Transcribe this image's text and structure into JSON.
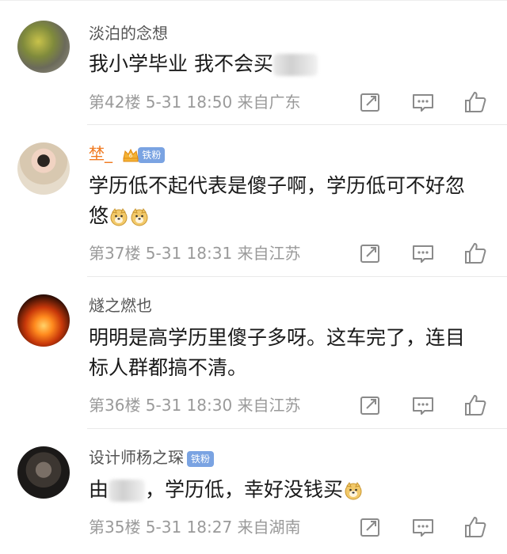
{
  "comments": [
    {
      "username": "淡泊的念想",
      "text": "我小学毕业 我不会买",
      "meta": "第42楼  5-31 18:50  来自广东"
    },
    {
      "username": "埜_",
      "badge": "铁粉",
      "crown_level": "6",
      "text_line1": "学历低不起代表是傻子啊，学历低可不好忽",
      "text_line2": "悠",
      "meta": "第37楼  5-31 18:31  来自江苏"
    },
    {
      "username": "燧之燃也",
      "text_line1": "明明是高学历里傻子多呀。这车完了，连目",
      "text_line2": "标人群都搞不清。",
      "meta": "第36楼  5-31 18:30  来自江苏"
    },
    {
      "username": "设计师杨之琛",
      "badge": "铁粉",
      "text_prefix": "由",
      "text": "，学历低，幸好没钱买",
      "meta": "第35楼  5-31 18:27  来自湖南"
    }
  ],
  "icons": {
    "share": "share-icon",
    "comment": "comment-icon",
    "like": "thumbs-up-icon",
    "emoji": "doge-emoji-icon"
  },
  "colors": {
    "username": "#555555",
    "username_vip": "#f07b22",
    "badge": "#7aa3e2",
    "meta": "#9a9a9a",
    "text": "#1a1a1a"
  }
}
